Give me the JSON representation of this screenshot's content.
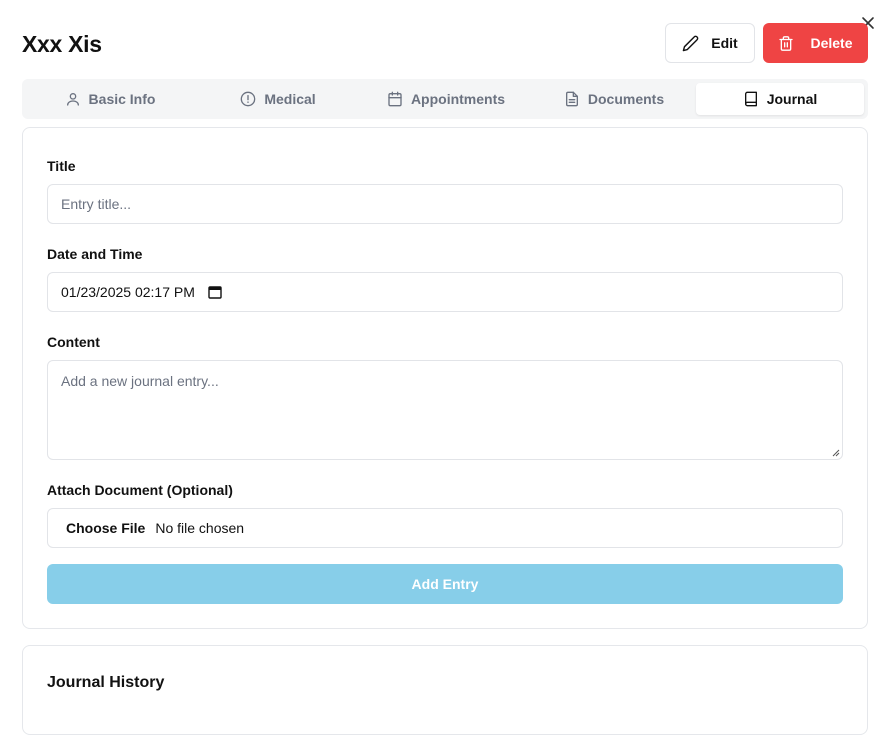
{
  "dialog": {
    "close_icon": "close-icon"
  },
  "header": {
    "name": "Xxx Xis",
    "edit_label": "Edit",
    "delete_label": "Delete",
    "delete_color": "#ef4444"
  },
  "tabs": [
    {
      "label": "Basic Info",
      "icon": "user-icon"
    },
    {
      "label": "Medical",
      "icon": "alert-circle-icon"
    },
    {
      "label": "Appointments",
      "icon": "calendar-icon"
    },
    {
      "label": "Documents",
      "icon": "file-text-icon"
    },
    {
      "label": "Journal",
      "icon": "book-icon",
      "active": true
    }
  ],
  "form": {
    "title_label": "Title",
    "title_placeholder": "Entry title...",
    "datetime_label": "Date and Time",
    "datetime_value": "01/23/2025 02:17 PM",
    "content_label": "Content",
    "content_placeholder": "Add a new journal entry...",
    "attach_label": "Attach Document (Optional)",
    "choose_file_label": "Choose File",
    "no_file_text": "No file chosen",
    "submit_label": "Add Entry",
    "submit_color": "#87cee9"
  },
  "history": {
    "title": "Journal History"
  }
}
